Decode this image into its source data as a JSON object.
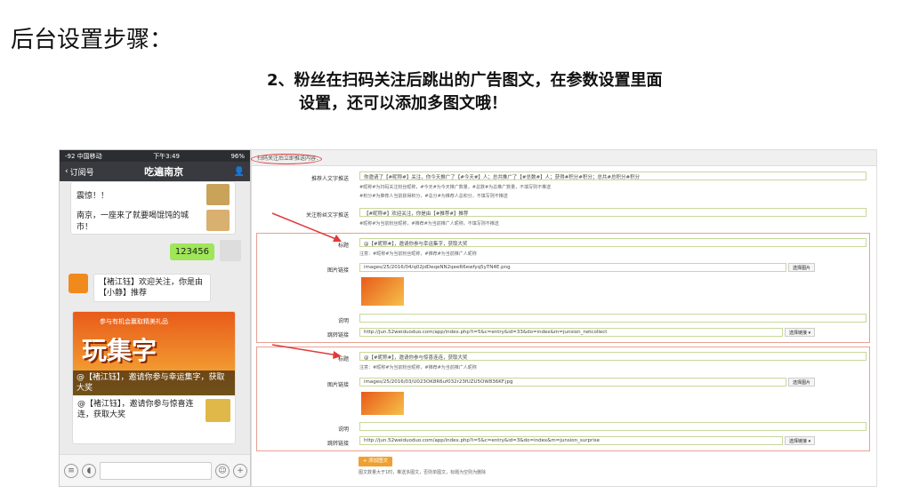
{
  "slide": {
    "title": "后台设置步骤：",
    "heading_line1": "2、粉丝在扫码关注后跳出的广告图文，在参数设置里面",
    "heading_line2": "设置，还可以添加多图文哦！"
  },
  "phone": {
    "status_left": "-92 中国移动 ",
    "status_time": "下午3:49",
    "status_right": "96%",
    "back_label": "订阅号",
    "chat_title": "吃遍南京",
    "card1_top": "震惊！！",
    "card1_text": "南京，一座来了就要喝馄饨的城市！",
    "green_bubble": "123456",
    "welcome_text": "【褚江钰】欢迎关注，你是由【小静】推荐",
    "banner_text": "玩集字",
    "banner_top": "参与有机会赢取精美礼品",
    "banner_caption": "@【褚江钰】，邀请你参与幸运集字，获取大奖",
    "news_item2": "@【褚江钰】，邀请你参与惊喜连连，获取大奖"
  },
  "panel": {
    "head_text": "扫码关注后立即推送内容：",
    "rec_label": "推荐人文字推送",
    "rec_value": "你邀请了【#昵称#】关注，你今天推广了【#今天#】人；总共推广了【#总数#】人；获得#积分#积分；总共#总积分#积分",
    "rec_hint1": "#昵称#为扫码关注粉丝昵称，#今天#为今天推广数量，#总数#为总推广数量，不填写则不推送",
    "rec_hint2": "#积分#为推荐人当前获得积分，#总分#为推荐人总积分，不填写则不推送",
    "fan_label": "关注粉丝文字推送",
    "fan_value": "【#昵称#】欢迎关注，你是由【#推荐#】推荐",
    "fan_hint": "#昵称#为当前粉丝昵称，#推荐#为当前推广人昵称，不填写则不推送",
    "item1": {
      "title_label": "标题",
      "title_value": "@【#昵称#】，邀请你参与幸运集字，获取大奖",
      "title_hint": "注意：#昵称#为当前粉丝昵称，#推荐#为当前推广人昵称",
      "img_label": "图片链接",
      "img_value": "images/25/2016/04/q02jdDeqeNN2qeeR6ewfyq5yTN4E.png",
      "img_btn": "选择图片",
      "desc_label": "说明",
      "link_label": "跳转链接",
      "link_value": "http://jun.52weiduoduo.com/app/index.php?i=5&c=entry&id=33&do=index&m=junsion_netcollect",
      "link_btn": "选择链接 ▾"
    },
    "item2": {
      "title_label": "标题",
      "title_value": "@【#昵称#】，邀请你参与惊喜连连，获取大奖",
      "title_hint": "注意：#昵称#为当前粉丝昵称，#推荐#为当前推广人昵称",
      "img_label": "图片链接",
      "img_value": "images/25/2016/03/U023OK8R6uf032r23fUZU5OW836KF.jpg",
      "img_btn": "选择图片",
      "desc_label": "说明",
      "link_label": "跳转链接",
      "link_value": "http://jun.52weiduoduo.com/app/index.php?i=5&c=entry&id=3&do=index&m=junsion_surprise",
      "link_btn": "选择链接 ▾"
    },
    "add_btn": "+ 添加图文",
    "add_hint": "图文数量大于1时，推送多图文，否则单图文，标题为空则为删除"
  },
  "colors": {
    "accent": "#e03b3b",
    "add_button": "#f0a030",
    "wechat_green": "#9fe658"
  }
}
